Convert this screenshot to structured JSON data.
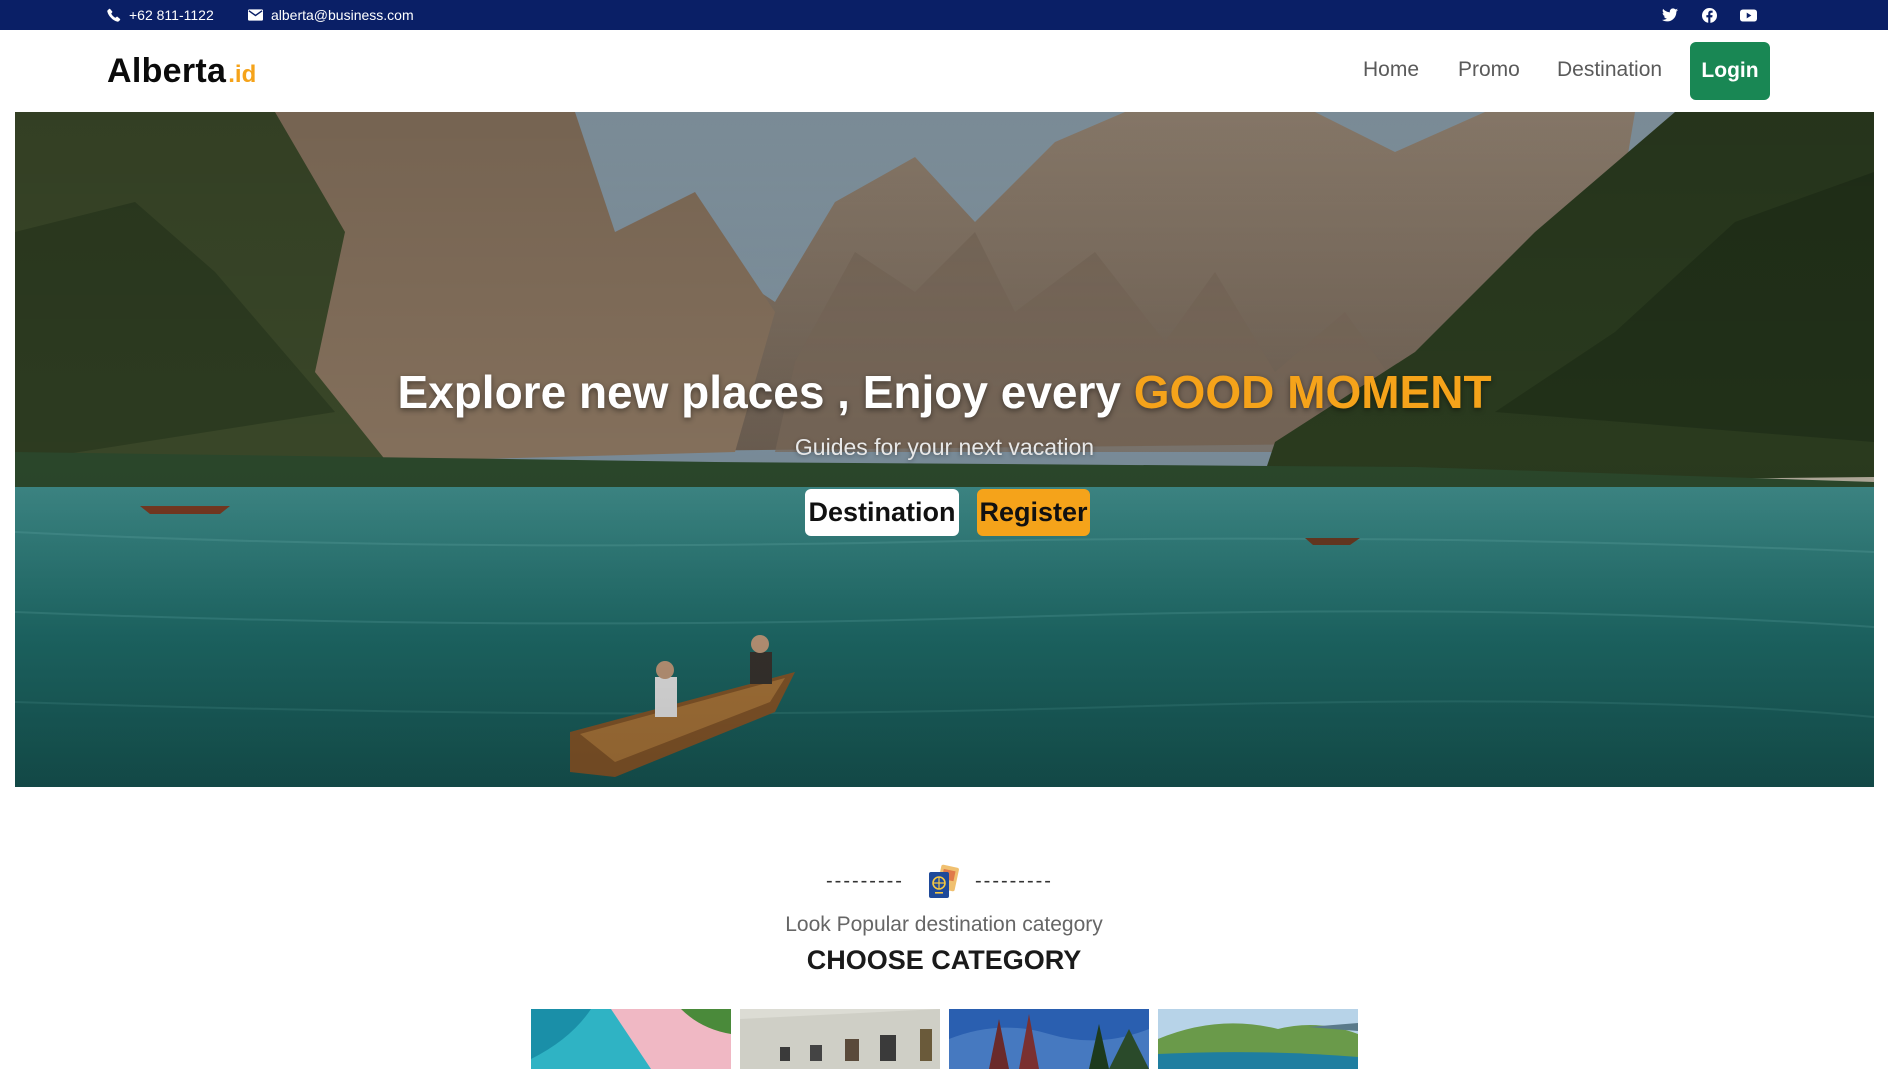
{
  "topbar": {
    "phone": "+62 811-1122",
    "email": "alberta@business.com",
    "icons": [
      "phone-icon",
      "mail-icon",
      "twitter-icon",
      "facebook-icon",
      "youtube-icon"
    ]
  },
  "navbar": {
    "brand_main": "Alberta",
    "brand_suffix": ".id",
    "links": [
      "Home",
      "Promo",
      "Destination"
    ],
    "login_label": "Login"
  },
  "hero": {
    "title_main": "Explore new places , Enjoy every ",
    "title_accent": "GOOD MOMENT",
    "subtitle": "Guides for your next vacation",
    "destination_button": "Destination",
    "register_button": "Register"
  },
  "category": {
    "dashes_left": "---------",
    "dashes_right": "---------",
    "subtitle": "Look Popular destination category",
    "title": "CHOOSE CATEGORY",
    "cards": [
      "beach-card",
      "museum-card",
      "temple-card",
      "island-card"
    ]
  },
  "colors": {
    "topbar": "#0a1f66",
    "accent": "#f5a31a",
    "login": "#198754"
  }
}
